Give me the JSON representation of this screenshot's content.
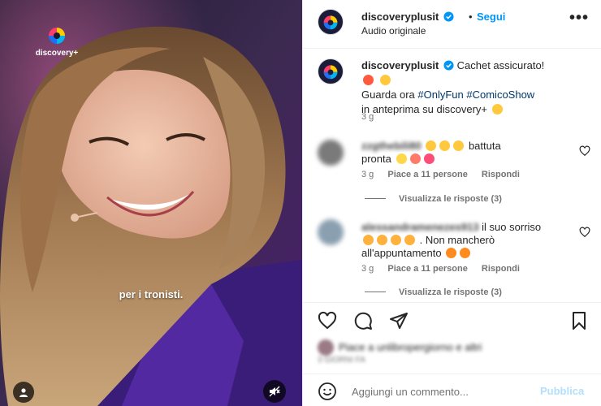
{
  "media": {
    "brand_name": "discovery+",
    "subtitle": "per i tronisti."
  },
  "header": {
    "username": "discoveryplusit",
    "dot": "•",
    "follow_label": "Segui",
    "audio_label": "Audio originale",
    "more_label": "•••"
  },
  "caption": {
    "username": "discoveryplusit",
    "line1": "Cachet assicurato!",
    "line2_prefix": "Guarda ora ",
    "hashtag1": "#OnlyFun",
    "hashtag2": "#ComicoShow",
    "line3": "in anteprima su discovery+",
    "time": "3 g"
  },
  "comments": [
    {
      "username": "zzgthebili80",
      "text_a": "battuta",
      "text_b": "pronta",
      "time": "3 g",
      "likes": "Piace a 11 persone",
      "reply": "Rispondi",
      "view_replies": "Visualizza le risposte (3)"
    },
    {
      "username": "alessandramenezes913",
      "text_a": "il suo sorriso",
      "text_b": ". Non mancherò",
      "text_c": "all'appuntamento",
      "time": "3 g",
      "likes": "Piace a 11 persone",
      "reply": "Rispondi",
      "view_replies": "Visualizza le risposte (3)"
    }
  ],
  "likes_summary": {
    "text": "Piace a unlibropergiorno e altri",
    "days": "3 GIORNI FA"
  },
  "composer": {
    "placeholder": "Aggiungi un commento...",
    "publish_label": "Pubblica"
  },
  "colors": {
    "accent": "#0095f6",
    "link": "#00376b",
    "muted": "#737373",
    "publish_disabled": "#b2dffc"
  }
}
